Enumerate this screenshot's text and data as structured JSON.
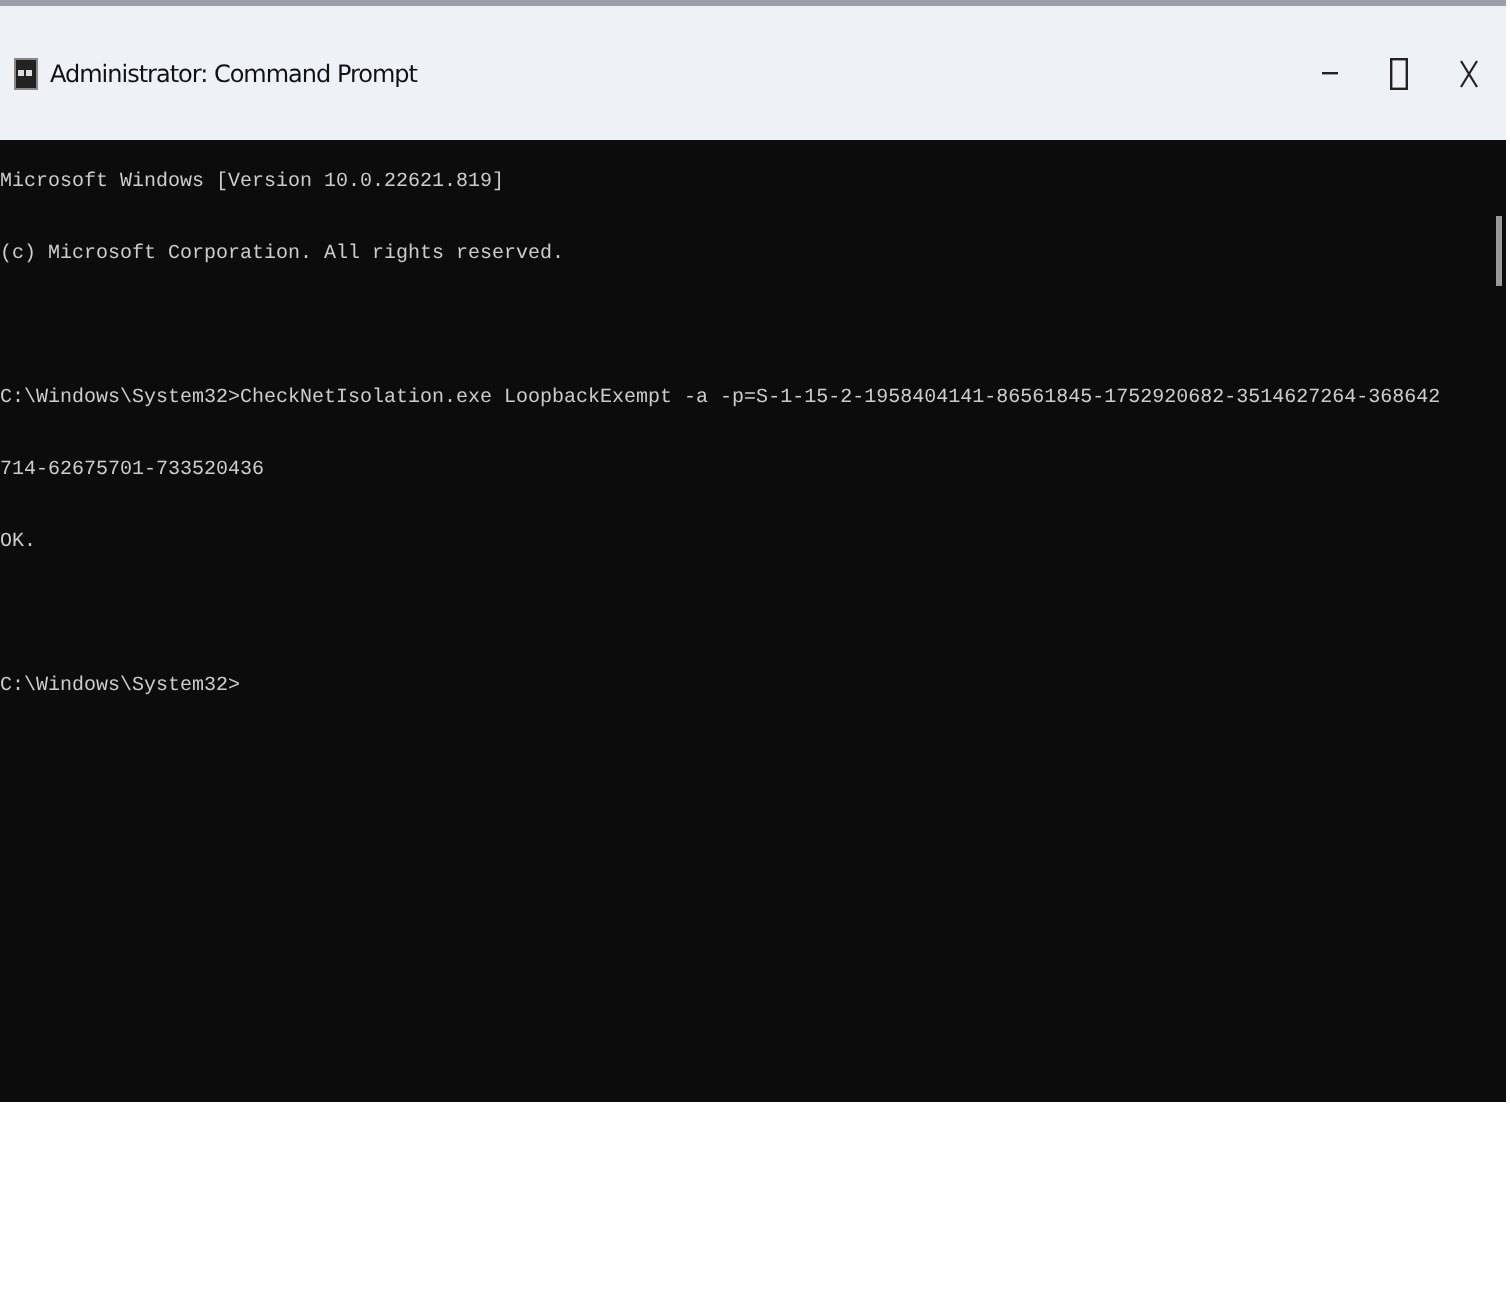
{
  "window": {
    "title": "Administrator: Command Prompt"
  },
  "console": {
    "lines": [
      {
        "text": "Microsoft Windows [Version 10.0.22621.819]",
        "blank_before": false
      },
      {
        "text": "(c) Microsoft Corporation. All rights reserved.",
        "blank_before": false
      },
      {
        "text": "C:\\Windows\\System32>CheckNetIsolation.exe LoopbackExempt -a -p=S-1-15-2-1958404141-86561845-1752920682-3514627264-368642",
        "blank_before": true
      },
      {
        "text": "714-62675701-733520436",
        "blank_before": false
      },
      {
        "text": "OK.",
        "blank_before": false
      },
      {
        "text": "C:\\Windows\\System32>",
        "blank_before": true
      }
    ]
  }
}
